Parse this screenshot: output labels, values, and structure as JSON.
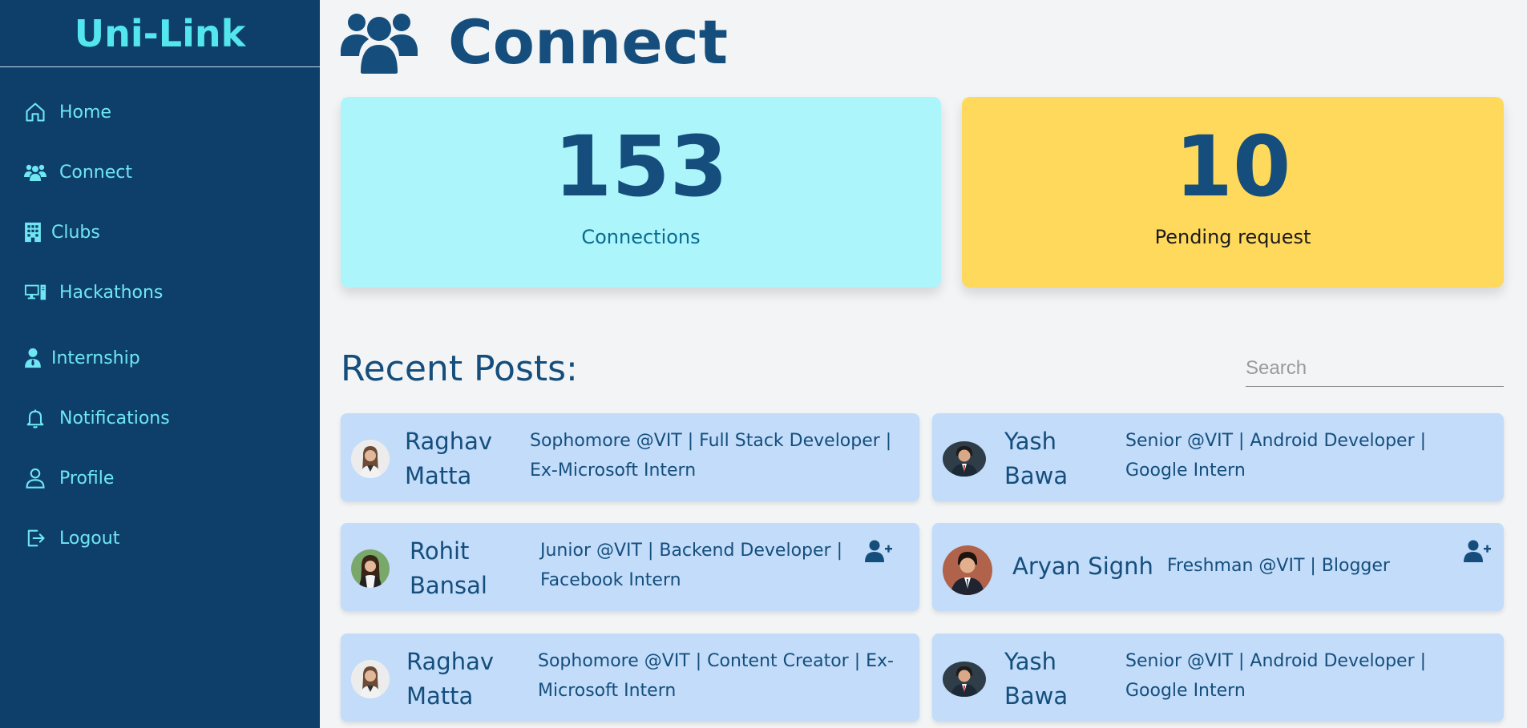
{
  "brand": "Uni-Link",
  "nav": [
    {
      "label": "Home",
      "icon": "home-icon"
    },
    {
      "label": "Connect",
      "icon": "users-icon"
    },
    {
      "label": "Clubs",
      "icon": "building-icon"
    },
    {
      "label": "Hackathons",
      "icon": "computer-icon"
    },
    {
      "label": "Internship",
      "icon": "user-tie-icon"
    },
    {
      "label": "Notifications",
      "icon": "bell-icon"
    },
    {
      "label": "Profile",
      "icon": "user-icon"
    },
    {
      "label": "Logout",
      "icon": "logout-icon"
    }
  ],
  "page": {
    "title": "Connect",
    "icon": "users-icon"
  },
  "stats": {
    "connections": {
      "value": "153",
      "label": "Connections"
    },
    "pending": {
      "value": "10",
      "label": "Pending request"
    }
  },
  "posts": {
    "title": "Recent Posts:",
    "search_placeholder": "Search",
    "items": [
      {
        "name": "Raghav Matta",
        "desc": "Sophomore @VIT | Full Stack Developer | Ex-Microsoft Intern",
        "add": false
      },
      {
        "name": "Yash Bawa",
        "desc": "Senior @VIT | Android Developer | Google Intern",
        "add": false
      },
      {
        "name": "Rohit Bansal",
        "desc": "Junior @VIT | Backend Developer | Facebook Intern",
        "add": true
      },
      {
        "name": "Aryan Signh",
        "desc": "Freshman @VIT | Blogger",
        "add": true
      },
      {
        "name": "Raghav Matta",
        "desc": "Sophomore @VIT | Content Creator | Ex-Microsoft Intern",
        "add": false
      },
      {
        "name": "Yash Bawa",
        "desc": "Senior @VIT | Android Developer | Google Intern",
        "add": false
      }
    ]
  },
  "colors": {
    "sidebar": "#0e3f6b",
    "accent": "#53e6ef",
    "primary": "#154e7c",
    "connections_bg": "#abf5fb",
    "pending_bg": "#ffd95b",
    "card_bg": "#c2dcfa"
  }
}
